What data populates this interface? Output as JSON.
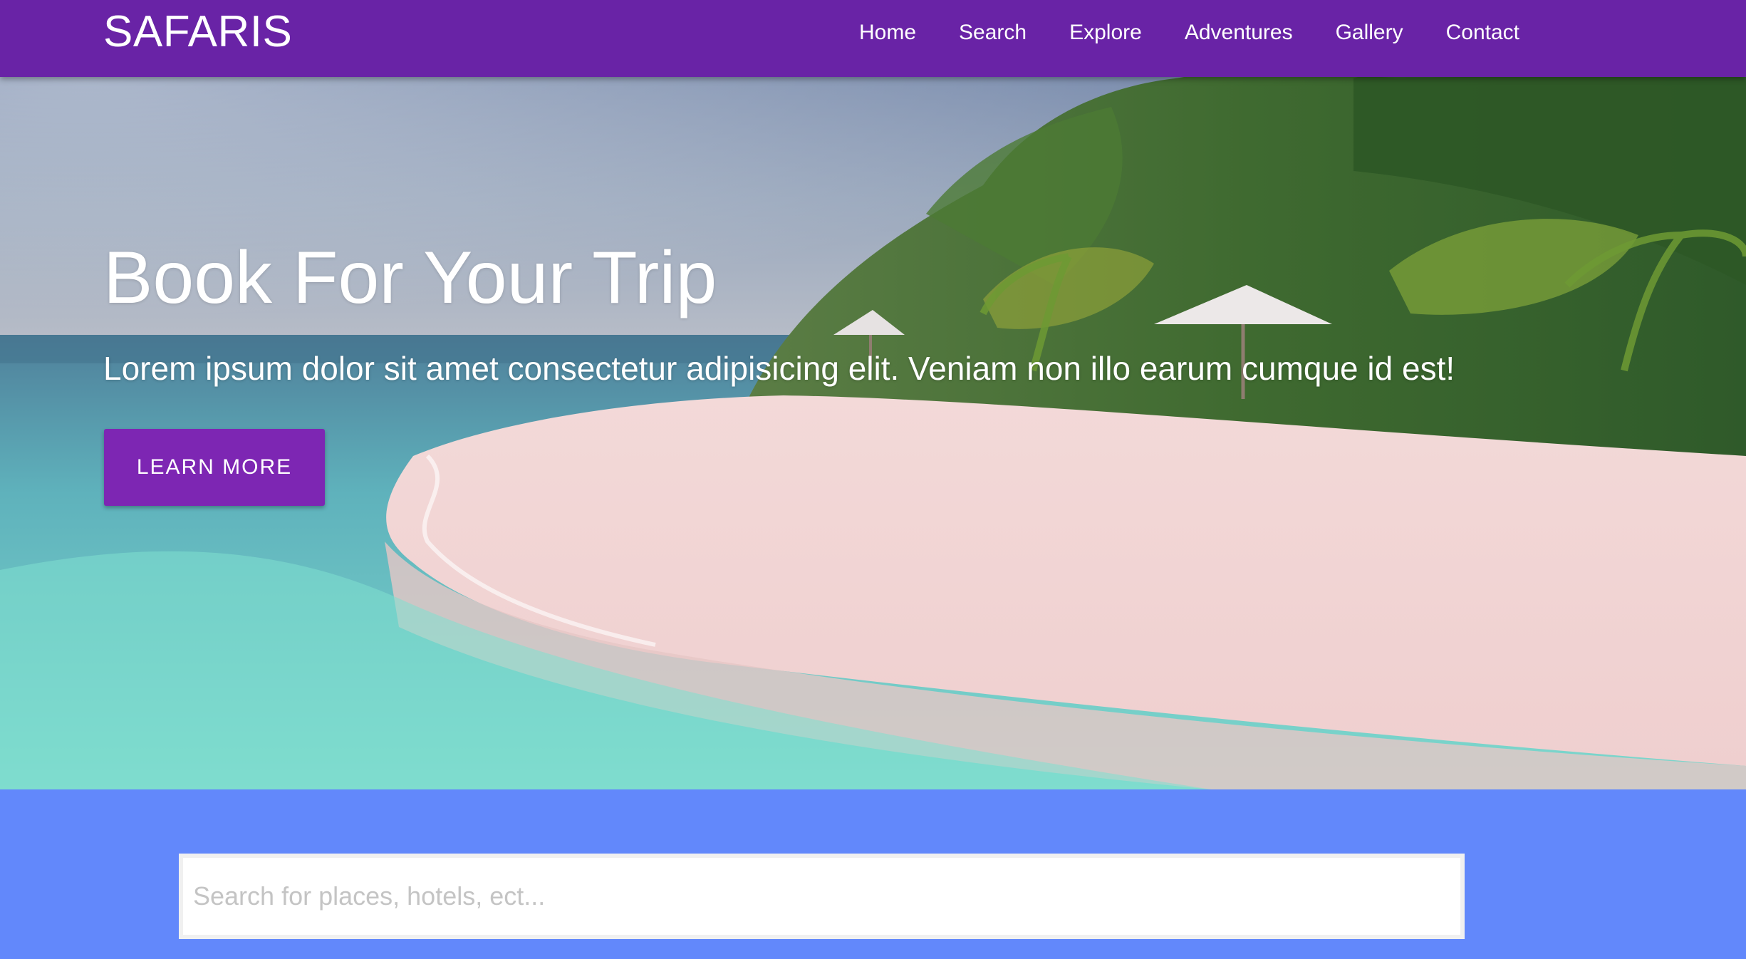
{
  "nav": {
    "brand": "SAFARIS",
    "links": [
      "Home",
      "Search",
      "Explore",
      "Adventures",
      "Gallery",
      "Contact"
    ]
  },
  "hero": {
    "title": "Book For Your Trip",
    "subtitle": "Lorem ipsum dolor sit amet consectetur adipisicing elit. Veniam non illo earum cumque id est!",
    "button_label": "LEARN MORE",
    "background": "tropical-beach-photo"
  },
  "search": {
    "placeholder": "Search for places, hotels, ect..."
  },
  "colors": {
    "navbar": "#6923a6",
    "button": "#7d26b3",
    "search_band": "#6288fb",
    "text": "#ffffff"
  }
}
